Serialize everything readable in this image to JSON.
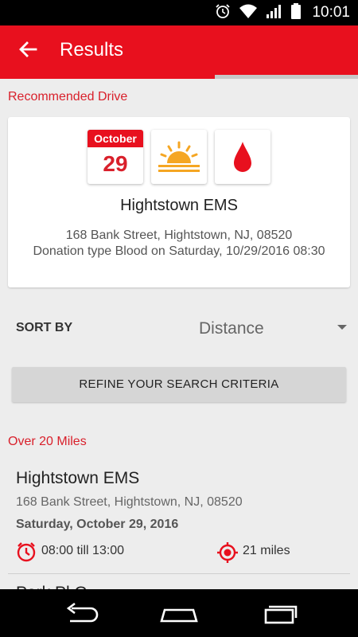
{
  "status_bar": {
    "time": "10:01",
    "icons": [
      "alarm-icon",
      "wifi-icon",
      "signal-icon",
      "battery-icon"
    ]
  },
  "app_bar": {
    "title": "Results",
    "back_icon": "arrow-back-icon"
  },
  "progress": {
    "fraction": 0.6
  },
  "recommended": {
    "section_label": "Recommended Drive",
    "calendar": {
      "month": "October",
      "day": "29"
    },
    "time_of_day_icon": "sunrise-icon",
    "donation_icon": "blood-drop-icon",
    "title": "Hightstown EMS",
    "address": "168 Bank Street, Hightstown, NJ, 08520",
    "details": "Donation type Blood on Saturday, 10/29/2016 08:30"
  },
  "sort": {
    "label": "SORT BY",
    "value": "Distance"
  },
  "refine_button": {
    "label": "REFINE YOUR SEARCH CRITERIA"
  },
  "results_group": {
    "label": "Over 20 Miles",
    "items": [
      {
        "title": "Hightstown EMS",
        "address": "168 Bank Street, Hightstown, NJ, 08520",
        "date": "Saturday, October 29, 2016",
        "time": "08:00 till 13:00",
        "distance": "21 miles"
      }
    ],
    "next_item_peek": "Park Pl G"
  },
  "nav_bar": {
    "icons": [
      "back-nav-icon",
      "home-nav-icon",
      "recents-nav-icon"
    ]
  },
  "colors": {
    "accent": "#e8101e",
    "accent_text": "#d9202b",
    "sun": "#f5a623",
    "background": "#ededed"
  }
}
